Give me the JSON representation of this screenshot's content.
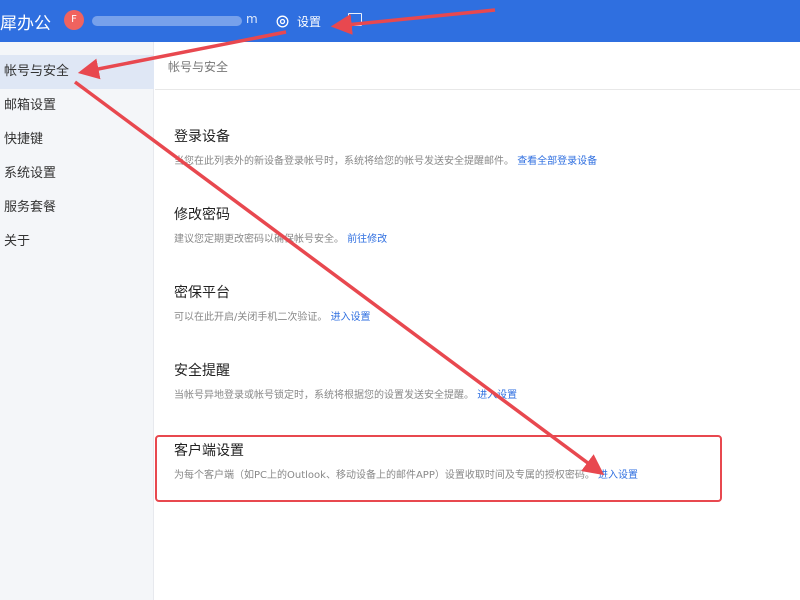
{
  "header": {
    "brand": "犀办公",
    "avatar_initial": "F",
    "account_tail": "m",
    "settings_label": "设置",
    "bg_color": "#2f6fe0"
  },
  "sidebar": {
    "items": [
      {
        "label": "帐号与安全",
        "active": true
      },
      {
        "label": "邮箱设置"
      },
      {
        "label": "快捷键"
      },
      {
        "label": "系统设置"
      },
      {
        "label": "服务套餐"
      },
      {
        "label": "关于"
      }
    ]
  },
  "main": {
    "breadcrumb": "帐号与安全",
    "sections": [
      {
        "title": "登录设备",
        "desc": "当您在此列表外的新设备登录帐号时，系统将给您的帐号发送安全提醒邮件。",
        "link": "查看全部登录设备"
      },
      {
        "title": "修改密码",
        "desc": "建议您定期更改密码以确保帐号安全。",
        "link": "前往修改"
      },
      {
        "title": "密保平台",
        "desc": "可以在此开启/关闭手机二次验证。",
        "link": "进入设置"
      },
      {
        "title": "安全提醒",
        "desc": "当帐号异地登录或帐号锁定时，系统将根据您的设置发送安全提醒。",
        "link": "进入设置"
      },
      {
        "title": "客户端设置",
        "desc": "为每个客户端（如PC上的Outlook、移动设备上的邮件APP）设置收取时间及专属的授权密码。",
        "link": "进入设置"
      }
    ]
  },
  "annotation": {
    "arrow_color": "#e8484f"
  }
}
